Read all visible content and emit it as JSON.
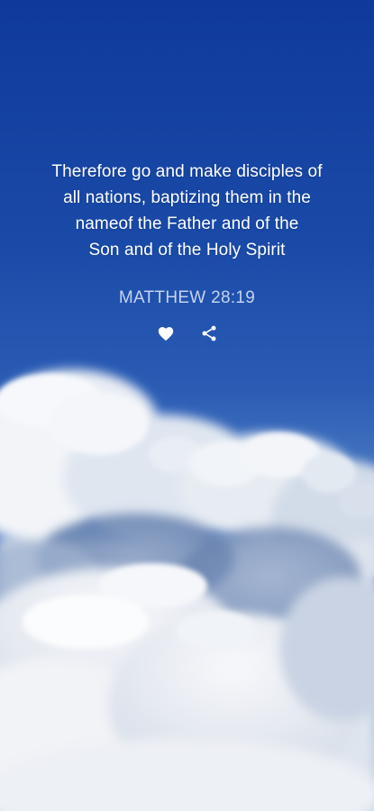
{
  "quote": {
    "text": "Therefore go and make disciples of\nall nations, baptizing them in the\nnameof the Father and of the\nSon and of the Holy Spirit",
    "reference": "MATTHEW 28:19"
  },
  "actions": {
    "like_icon": "heart-icon",
    "share_icon": "share-icon"
  },
  "colors": {
    "sky_top": "#0f3a9c",
    "text": "#ffffff",
    "reference": "#c6d3ef"
  }
}
